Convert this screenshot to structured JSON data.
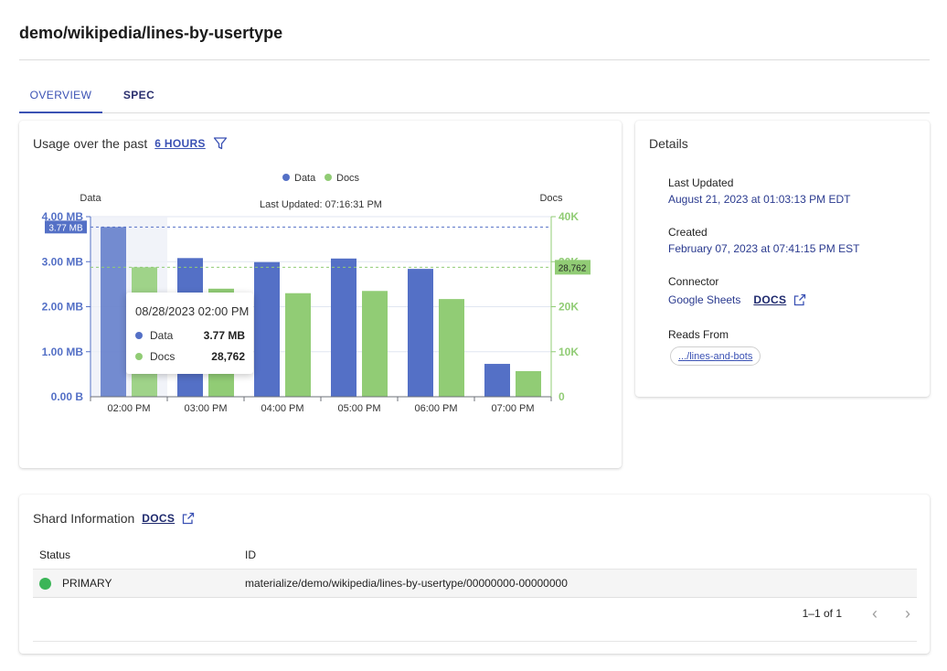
{
  "page": {
    "title": "demo/wikipedia/lines-by-usertype"
  },
  "tabs": [
    {
      "label": "OVERVIEW",
      "active": true
    },
    {
      "label": "SPEC",
      "active": false
    }
  ],
  "usage": {
    "title": "Usage over the past",
    "range_link": "6 HOURS",
    "legend": [
      {
        "label": "Data",
        "color": "#5470c6"
      },
      {
        "label": "Docs",
        "color": "#91cc75"
      }
    ],
    "left_axis_title": "Data",
    "right_axis_title": "Docs",
    "last_updated": "Last Updated: 07:16:31 PM",
    "hover_left_label": "3.77 MB",
    "hover_right_label": "28,762",
    "tooltip": {
      "date": "08/28/2023 02:00 PM",
      "rows": [
        {
          "label": "Data",
          "value": "3.77 MB"
        },
        {
          "label": "Docs",
          "value": "28,762"
        }
      ]
    }
  },
  "chart_data": {
    "type": "bar",
    "categories": [
      "02:00 PM",
      "03:00 PM",
      "04:00 PM",
      "05:00 PM",
      "06:00 PM",
      "07:00 PM"
    ],
    "series": [
      {
        "name": "Data",
        "axis": "left",
        "unit": "MB",
        "color": "#5470c6",
        "values": [
          3.77,
          3.08,
          2.99,
          3.07,
          2.84,
          0.73
        ]
      },
      {
        "name": "Docs",
        "axis": "right",
        "color": "#91cc75",
        "values": [
          28762,
          24000,
          23000,
          23500,
          21700,
          5700
        ]
      }
    ],
    "left_axis": {
      "label": "Data",
      "ylim": [
        0,
        4
      ],
      "ticks": [
        "0.00 B",
        "1.00 MB",
        "2.00 MB",
        "3.00 MB",
        "4.00 MB"
      ]
    },
    "right_axis": {
      "label": "Docs",
      "ylim": [
        0,
        40000
      ],
      "ticks": [
        "0",
        "10K",
        "20K",
        "30K",
        "40K"
      ]
    },
    "highlighted_category": "02:00 PM",
    "grid": true,
    "legend_position": "top-center"
  },
  "details": {
    "title": "Details",
    "last_updated_label": "Last Updated",
    "last_updated_value": "August 21, 2023 at 01:03:13 PM EDT",
    "created_label": "Created",
    "created_value": "February 07, 2023 at 07:41:15 PM EST",
    "connector_label": "Connector",
    "connector_value": "Google Sheets",
    "connector_docs": "DOCS",
    "reads_from_label": "Reads From",
    "reads_from_value": ".../lines-and-bots"
  },
  "shards": {
    "title": "Shard Information",
    "docs_link": "DOCS",
    "columns": [
      "Status",
      "ID"
    ],
    "rows": [
      {
        "status": "PRIMARY",
        "status_color": "#3bb557",
        "id": "materialize/demo/wikipedia/lines-by-usertype/00000000-00000000"
      }
    ],
    "pagination": "1–1 of 1"
  },
  "icons": [
    "filter-icon",
    "external-link-icon",
    "chevron-left-icon",
    "chevron-right-icon"
  ]
}
